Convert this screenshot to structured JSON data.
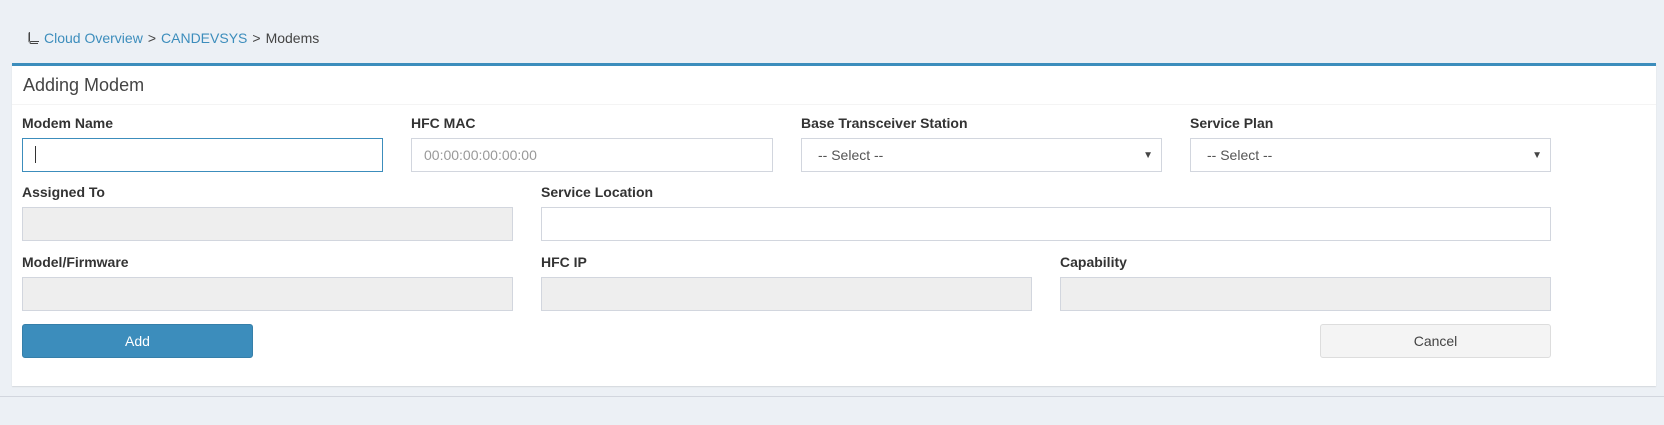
{
  "breadcrumb": {
    "icon": "book-icon",
    "items": [
      "Cloud Overview",
      "CANDEVSYS",
      "Modems"
    ],
    "separator": ">"
  },
  "form": {
    "title": "Adding Modem",
    "modem_name": {
      "label": "Modem Name",
      "value": ""
    },
    "hfc_mac": {
      "label": "HFC MAC",
      "placeholder": "00:00:00:00:00:00"
    },
    "base_station": {
      "label": "Base Transceiver Station",
      "selected": "-- Select --"
    },
    "service_plan": {
      "label": "Service Plan",
      "selected": "-- Select --"
    },
    "assigned_to": {
      "label": "Assigned To",
      "value": ""
    },
    "service_location": {
      "label": "Service Location",
      "value": ""
    },
    "model_firmware": {
      "label": "Model/Firmware",
      "value": ""
    },
    "hfc_ip": {
      "label": "HFC IP",
      "value": ""
    },
    "capability": {
      "label": "Capability",
      "value": ""
    },
    "add_label": "Add",
    "cancel_label": "Cancel"
  },
  "colors": {
    "accent": "#3c8dbc",
    "page_bg": "#ecf0f5",
    "readonly_bg": "#eeeeee"
  }
}
